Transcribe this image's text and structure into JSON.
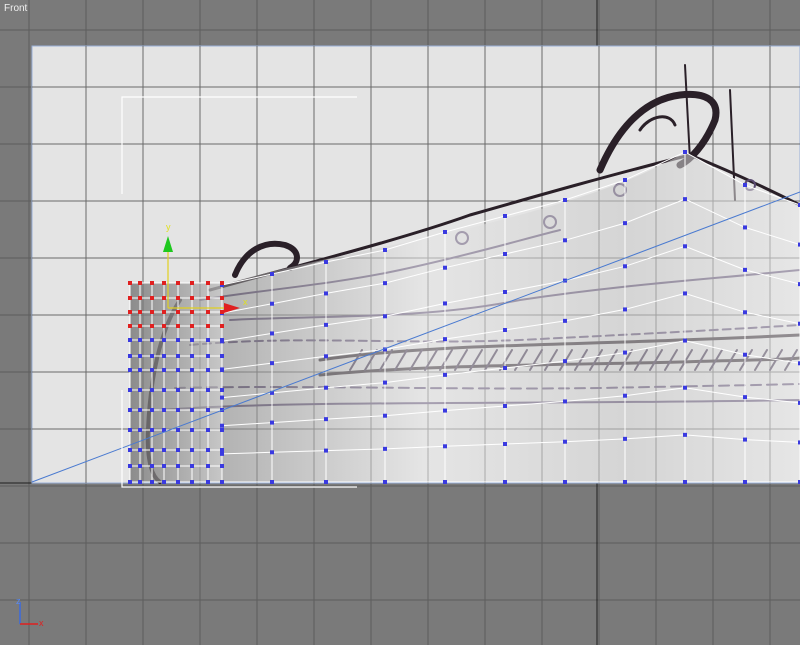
{
  "viewport": {
    "label": "Front",
    "background_color": "#7a7a7a",
    "grid_color": "#5c5c5c",
    "home_grid_axis_color": "#1e1e1e"
  },
  "reference_plane": {
    "content": "shoe-side-sketch",
    "fill_color": "#e4e4e4"
  },
  "mesh": {
    "wire_color": "#ffffff",
    "vertex_color": "#3a3ae0",
    "selected_vertex_color": "#e02020",
    "shading_light": "#e6e6e6",
    "shading_dark": "#8a8a8a"
  },
  "gizmo": {
    "x_label": "x",
    "y_label": "y",
    "x_color": "#e02020",
    "y_color": "#1ec81e"
  },
  "axis_tripod": {
    "x_label": "x",
    "z_label": "z",
    "x_color": "#e02020",
    "z_color": "#3a6ae0"
  },
  "construction_line_color": "#4a7ad0"
}
